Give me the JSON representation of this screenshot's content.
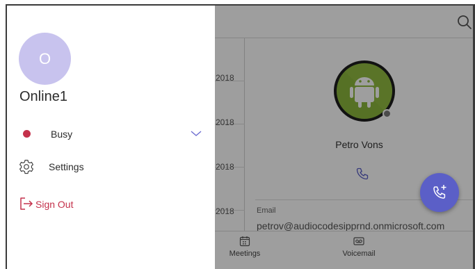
{
  "app": {
    "list_dates": [
      "2018",
      "2018",
      "2018",
      "2018"
    ]
  },
  "contact": {
    "name": "Petro Vons",
    "email_label": "Email",
    "email": "petrov@audiocodesipprnd.onmicrosoft.com",
    "avatar_icon": "android-icon",
    "presence": "offline"
  },
  "bottom_nav": {
    "items": [
      {
        "label": "Meetings",
        "icon": "calendar-icon"
      },
      {
        "label": "Voicemail",
        "icon": "voicemail-icon"
      }
    ]
  },
  "drawer": {
    "user_initial": "O",
    "user_name": "Online1",
    "status": {
      "label": "Busy",
      "color": "#c4314b"
    },
    "menu": {
      "settings": "Settings",
      "sign_out": "Sign Out"
    }
  },
  "colors": {
    "accent": "#5b5fc7",
    "danger": "#c4314b",
    "avatar_bg": "#c8c3ee"
  }
}
